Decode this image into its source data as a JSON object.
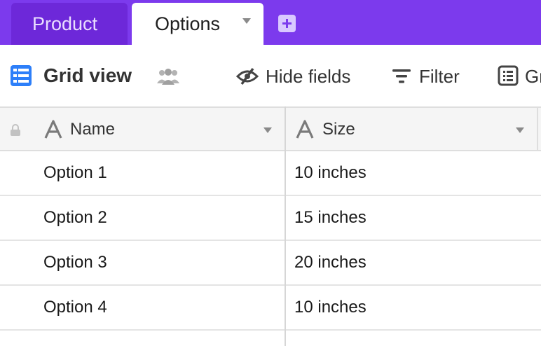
{
  "tabs": [
    {
      "label": "Product"
    },
    {
      "label": "Options"
    }
  ],
  "toolbar": {
    "view_name": "Grid view",
    "hide_fields": "Hide fields",
    "filter": "Filter",
    "group": "Gr"
  },
  "columns": [
    {
      "label": "Name"
    },
    {
      "label": "Size"
    }
  ],
  "rows": [
    {
      "name": "Option 1",
      "size": "10 inches"
    },
    {
      "name": "Option 2",
      "size": "15 inches"
    },
    {
      "name": "Option 3",
      "size": "20 inches"
    },
    {
      "name": "Option 4",
      "size": "10 inches"
    }
  ],
  "colors": {
    "tabbar": "#7c3aed",
    "active_tab": "#ffffff",
    "grid_icon": "#2d7ff9"
  },
  "icons": [
    "grid-view-icon",
    "people-icon",
    "hide-fields-icon",
    "filter-icon",
    "group-icon",
    "lock-icon",
    "text-field-icon",
    "add-tab-icon"
  ]
}
